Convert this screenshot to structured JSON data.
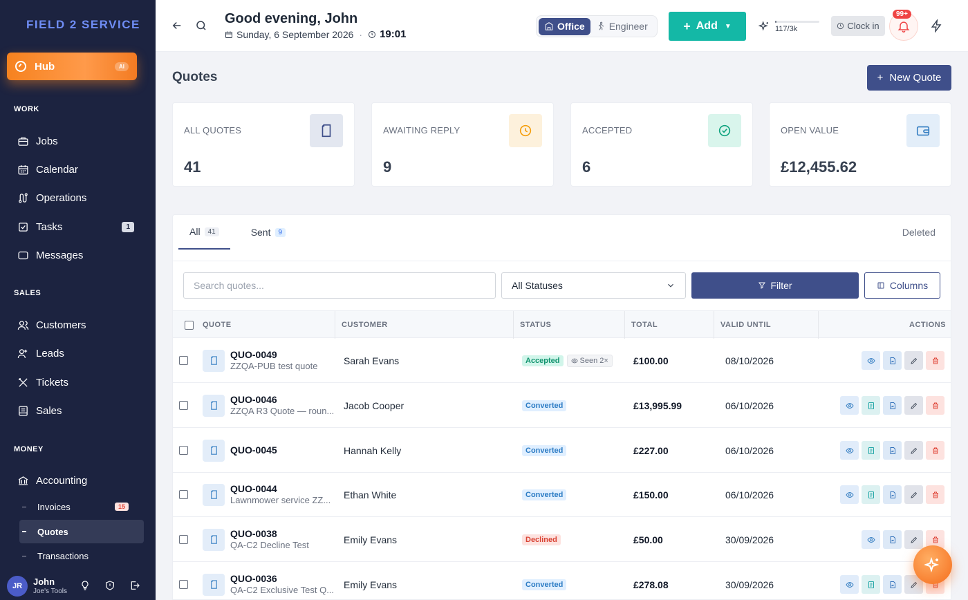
{
  "sidebar": {
    "logo": "FIELD 2 SERVICE",
    "hub": {
      "label": "Hub",
      "badge": "AI"
    },
    "sections": {
      "work": "WORK",
      "sales": "SALES",
      "money": "MONEY"
    },
    "work_items": [
      {
        "label": "Jobs",
        "icon": "briefcase-icon"
      },
      {
        "label": "Calendar",
        "icon": "calendar-icon"
      },
      {
        "label": "Operations",
        "icon": "route-icon"
      },
      {
        "label": "Tasks",
        "icon": "checkbox-icon",
        "badge": "1"
      },
      {
        "label": "Messages",
        "icon": "chat-icon"
      }
    ],
    "sales_items": [
      {
        "label": "Customers",
        "icon": "users-icon"
      },
      {
        "label": "Leads",
        "icon": "user-plus-icon"
      },
      {
        "label": "Tickets",
        "icon": "tools-icon"
      },
      {
        "label": "Sales",
        "icon": "receipt-icon"
      }
    ],
    "money_items": [
      {
        "label": "Accounting",
        "icon": "bank-icon"
      }
    ],
    "money_sub": [
      {
        "label": "Invoices",
        "badge": "15"
      },
      {
        "label": "Quotes",
        "active": true
      },
      {
        "label": "Transactions"
      }
    ],
    "user": {
      "initials": "JR",
      "name": "John",
      "org": "Joe's Tools"
    }
  },
  "header": {
    "greeting": "Good evening, John",
    "date": "Sunday, 6 September 2026",
    "time": "19:01",
    "mode": {
      "office": "Office",
      "engineer": "Engineer",
      "selected": "Office"
    },
    "add_label": "Add",
    "ai_credits": {
      "text": "117/3k",
      "fraction": 0.039
    },
    "clock_in": "Clock in",
    "notifications_badge": "99+"
  },
  "page": {
    "title": "Quotes",
    "new_quote": "New Quote"
  },
  "stats": [
    {
      "label": "ALL QUOTES",
      "value": "41",
      "icon": "document-icon",
      "color": "#3f4f8a",
      "bg": "#e3e7f0"
    },
    {
      "label": "AWAITING REPLY",
      "value": "9",
      "icon": "clock-icon",
      "color": "#f59e0b",
      "bg": "#fdf1dc"
    },
    {
      "label": "ACCEPTED",
      "value": "6",
      "icon": "check-circle-icon",
      "color": "#10a37f",
      "bg": "#d9f5ec"
    },
    {
      "label": "OPEN VALUE",
      "value": "£12,455.62",
      "icon": "wallet-icon",
      "color": "#3b82c4",
      "bg": "#e3eef9"
    }
  ],
  "tabs": [
    {
      "label": "All",
      "count": "41"
    },
    {
      "label": "Sent",
      "count": "9"
    }
  ],
  "deleted_label": "Deleted",
  "toolbar": {
    "search_placeholder": "Search quotes...",
    "status_value": "All Statuses",
    "filter": "Filter",
    "columns": "Columns"
  },
  "table": {
    "headers": [
      "QUOTE",
      "CUSTOMER",
      "STATUS",
      "TOTAL",
      "VALID UNTIL",
      "ACTIONS"
    ],
    "rows": [
      {
        "number": "QUO-0049",
        "desc": "ZZQA-PUB test quote",
        "customer": "Sarah Evans",
        "status": "Accepted",
        "seen": "Seen 2×",
        "total": "£100.00",
        "valid": "08/10/2026",
        "actions": [
          "view",
          "pdf",
          "edit",
          "delete"
        ]
      },
      {
        "number": "QUO-0046",
        "desc": "ZZQA R3 Quote — roun...",
        "customer": "Jacob Cooper",
        "status": "Converted",
        "total": "£13,995.99",
        "valid": "06/10/2026",
        "actions": [
          "view",
          "doc",
          "pdf",
          "edit",
          "delete"
        ]
      },
      {
        "number": "QUO-0045",
        "desc": "",
        "customer": "Hannah Kelly",
        "status": "Converted",
        "total": "£227.00",
        "valid": "06/10/2026",
        "actions": [
          "view",
          "doc",
          "pdf",
          "edit",
          "delete"
        ]
      },
      {
        "number": "QUO-0044",
        "desc": "Lawnmower service ZZ...",
        "customer": "Ethan White",
        "status": "Converted",
        "total": "£150.00",
        "valid": "06/10/2026",
        "actions": [
          "view",
          "doc",
          "pdf",
          "edit",
          "delete"
        ]
      },
      {
        "number": "QUO-0038",
        "desc": "QA-C2 Decline Test",
        "customer": "Emily Evans",
        "status": "Declined",
        "total": "£50.00",
        "valid": "30/09/2026",
        "actions": [
          "view",
          "pdf",
          "edit",
          "delete"
        ]
      },
      {
        "number": "QUO-0036",
        "desc": "QA-C2 Exclusive Test Q...",
        "customer": "Emily Evans",
        "status": "Converted",
        "total": "£278.08",
        "valid": "30/09/2026",
        "actions": [
          "view",
          "doc",
          "pdf",
          "edit",
          "delete"
        ]
      }
    ]
  }
}
